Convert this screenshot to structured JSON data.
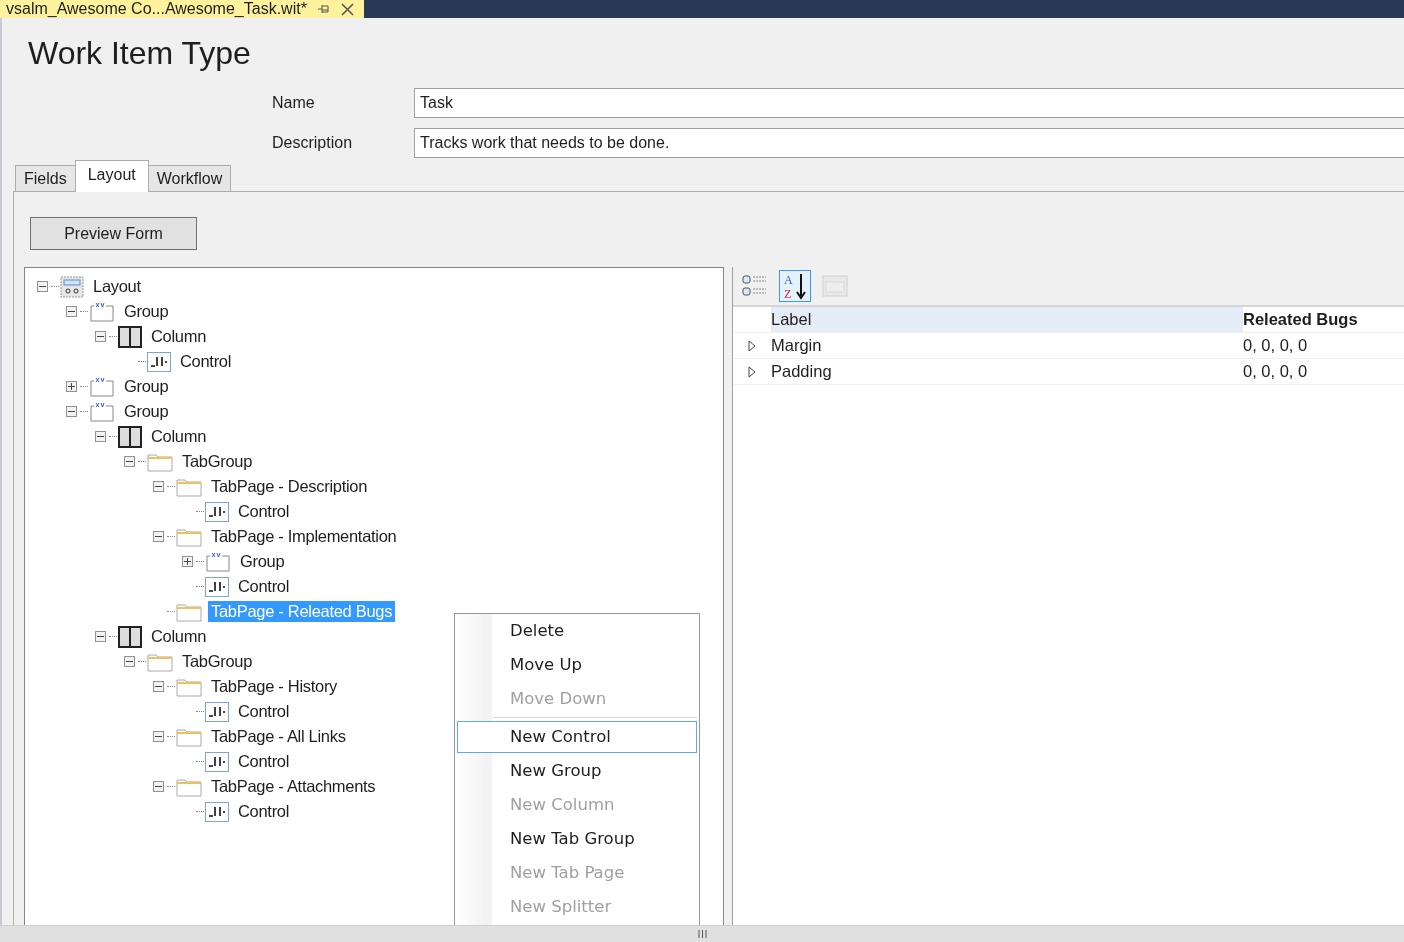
{
  "document_tab": {
    "title": "vsalm_Awesome Co...Awesome_Task.wit*"
  },
  "heading": "Work Item Type",
  "form": [
    {
      "label": "Name",
      "value": "Task"
    },
    {
      "label": "Description",
      "value": "Tracks work that needs to be done."
    }
  ],
  "tabs": [
    {
      "label": "Fields",
      "selected": false
    },
    {
      "label": "Layout",
      "selected": true
    },
    {
      "label": "Workflow",
      "selected": false
    }
  ],
  "preview_button": "Preview Form",
  "tree": [
    {
      "label": "Layout",
      "kind": "layout",
      "expanded": true,
      "selected": false,
      "children": [
        {
          "label": "Group",
          "kind": "group",
          "expanded": true,
          "selected": false,
          "children": [
            {
              "label": "Column",
              "kind": "column",
              "expanded": true,
              "selected": false,
              "children": [
                {
                  "label": "Control",
                  "kind": "control",
                  "selected": false
                }
              ]
            }
          ]
        },
        {
          "label": "Group",
          "kind": "group",
          "expanded": false,
          "selected": false
        },
        {
          "label": "Group",
          "kind": "group",
          "expanded": true,
          "selected": false,
          "children": [
            {
              "label": "Column",
              "kind": "column",
              "expanded": true,
              "selected": false,
              "children": [
                {
                  "label": "TabGroup",
                  "kind": "folder",
                  "expanded": true,
                  "selected": false,
                  "children": [
                    {
                      "label": "TabPage - Description",
                      "kind": "folder",
                      "expanded": true,
                      "selected": false,
                      "children": [
                        {
                          "label": "Control",
                          "kind": "control",
                          "selected": false
                        }
                      ]
                    },
                    {
                      "label": "TabPage - Implementation",
                      "kind": "folder",
                      "expanded": true,
                      "selected": false,
                      "children": [
                        {
                          "label": "Group",
                          "kind": "group",
                          "expanded": false,
                          "selected": false
                        },
                        {
                          "label": "Control",
                          "kind": "control",
                          "selected": false
                        }
                      ]
                    },
                    {
                      "label": "TabPage - Releated Bugs",
                      "kind": "folder",
                      "selected": true
                    }
                  ]
                }
              ]
            },
            {
              "label": "Column",
              "kind": "column",
              "expanded": true,
              "selected": false,
              "children": [
                {
                  "label": "TabGroup",
                  "kind": "folder",
                  "expanded": true,
                  "selected": false,
                  "children": [
                    {
                      "label": "TabPage - History",
                      "kind": "folder",
                      "expanded": true,
                      "selected": false,
                      "children": [
                        {
                          "label": "Control",
                          "kind": "control",
                          "selected": false
                        }
                      ]
                    },
                    {
                      "label": "TabPage - All Links",
                      "kind": "folder",
                      "expanded": true,
                      "selected": false,
                      "children": [
                        {
                          "label": "Control",
                          "kind": "control",
                          "selected": false
                        }
                      ]
                    },
                    {
                      "label": "TabPage - Attachments",
                      "kind": "folder",
                      "expanded": true,
                      "selected": false,
                      "children": [
                        {
                          "label": "Control",
                          "kind": "control",
                          "selected": false
                        }
                      ]
                    }
                  ]
                }
              ]
            }
          ]
        }
      ]
    }
  ],
  "property_toolbar": [
    {
      "kind": "categorized",
      "selected": false,
      "disabled": false
    },
    {
      "kind": "alphabetical",
      "selected": true,
      "disabled": false,
      "glyph_top": "A",
      "glyph_bottom": "Z"
    },
    {
      "kind": "pages",
      "selected": false,
      "disabled": true
    }
  ],
  "properties": [
    {
      "name": "Label",
      "value": "Releated Bugs",
      "expandable": false,
      "selected": true,
      "modified": true
    },
    {
      "name": "Margin",
      "value": "0, 0, 0, 0",
      "expandable": true,
      "selected": false,
      "modified": false
    },
    {
      "name": "Padding",
      "value": "0, 0, 0, 0",
      "expandable": true,
      "selected": false,
      "modified": false
    }
  ],
  "context_menu": [
    {
      "kind": "item",
      "label": "Delete",
      "disabled": false,
      "selected": false
    },
    {
      "kind": "item",
      "label": "Move Up",
      "disabled": false,
      "selected": false
    },
    {
      "kind": "item",
      "label": "Move Down",
      "disabled": true,
      "selected": false
    },
    {
      "kind": "separator"
    },
    {
      "kind": "item",
      "label": "New Control",
      "disabled": false,
      "selected": true
    },
    {
      "kind": "item",
      "label": "New Group",
      "disabled": false,
      "selected": false
    },
    {
      "kind": "item",
      "label": "New Column",
      "disabled": true,
      "selected": false
    },
    {
      "kind": "item",
      "label": "New Tab Group",
      "disabled": false,
      "selected": false
    },
    {
      "kind": "item",
      "label": "New Tab Page",
      "disabled": true,
      "selected": false
    },
    {
      "kind": "item",
      "label": "New Splitter",
      "disabled": true,
      "selected": false
    }
  ]
}
